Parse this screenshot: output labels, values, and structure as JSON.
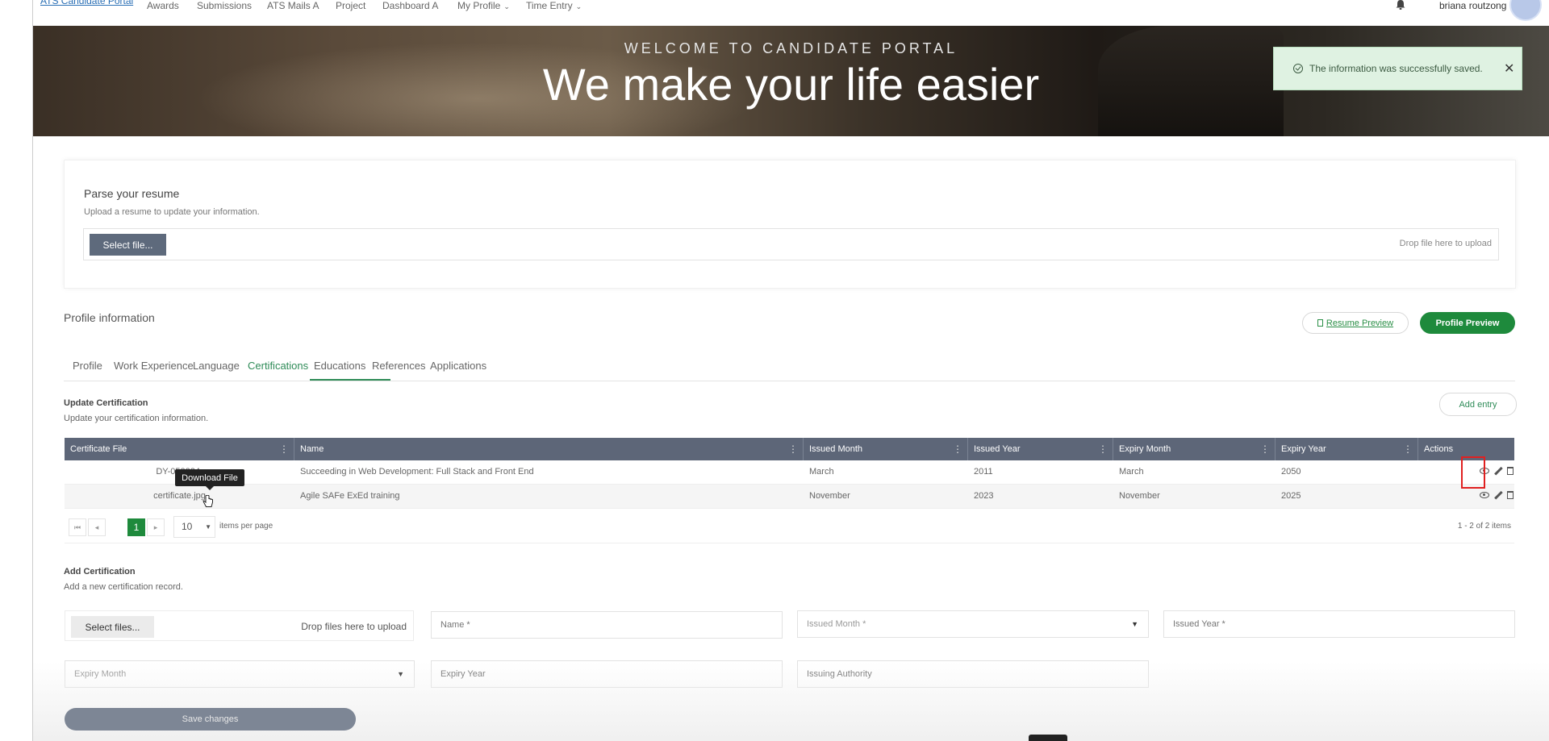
{
  "topnav": {
    "brand": "ATS Candidate Portal",
    "items": [
      "Awards",
      "Submissions",
      "ATS Mails A",
      "Project",
      "Dashboard A",
      "My Profile",
      "Time Entry"
    ],
    "username": "briana routzong"
  },
  "hero": {
    "eyebrow": "WELCOME TO CANDIDATE PORTAL",
    "headline": "We make your life easier"
  },
  "toast": {
    "message": "The information was successfully saved.",
    "close": "✕"
  },
  "parse": {
    "title": "Parse your resume",
    "subtitle": "Upload a resume to update your information.",
    "select_label": "Select file...",
    "drop_hint": "Drop file here to upload"
  },
  "profile": {
    "title": "Profile information",
    "resume_preview": "Resume Preview",
    "profile_preview": "Profile Preview",
    "tabs": [
      "Profile",
      "Work Experience",
      "Language",
      "Certifications",
      "Educations",
      "References",
      "Applications"
    ],
    "active_tab": "Certifications"
  },
  "update_cert": {
    "title": "Update Certification",
    "subtitle": "Update your certification information.",
    "add_entry": "Add entry"
  },
  "table": {
    "columns": [
      "Certificate File",
      "Name",
      "Issued Month",
      "Issued Year",
      "Expiry Month",
      "Expiry Year",
      "Actions"
    ],
    "rows": [
      {
        "file": "DY-052224-",
        "name": "Succeeding in Web Development: Full Stack and Front End",
        "issued_month": "March",
        "issued_year": "2011",
        "expiry_month": "March",
        "expiry_year": "2050"
      },
      {
        "file": "certificate.jpg",
        "name": "Agile SAFe ExEd training",
        "issued_month": "November",
        "issued_year": "2023",
        "expiry_month": "November",
        "expiry_year": "2025"
      }
    ],
    "tooltip": "Download File"
  },
  "pager": {
    "first": "⏮",
    "prev": "◂",
    "current": "1",
    "next": "▸",
    "last": "⏭",
    "page_size": "10",
    "per_page_label": "items per page",
    "count": "1 - 2 of 2 items"
  },
  "add_cert": {
    "title": "Add Certification",
    "subtitle": "Add a new certification record.",
    "select_files": "Select files...",
    "drop_hint": "Drop files here to upload",
    "name_placeholder": "Name *",
    "issued_month_placeholder": "Issued Month *",
    "issued_year_placeholder": "Issued Year *",
    "expiry_month_placeholder": "Expiry Month",
    "expiry_year_placeholder": "Expiry Year",
    "issuing_authority_placeholder": "Issuing Authority",
    "save": "Save changes"
  },
  "colors": {
    "accent": "#1e8a3c",
    "table_header": "#5d6678",
    "highlight": "#e02020"
  }
}
